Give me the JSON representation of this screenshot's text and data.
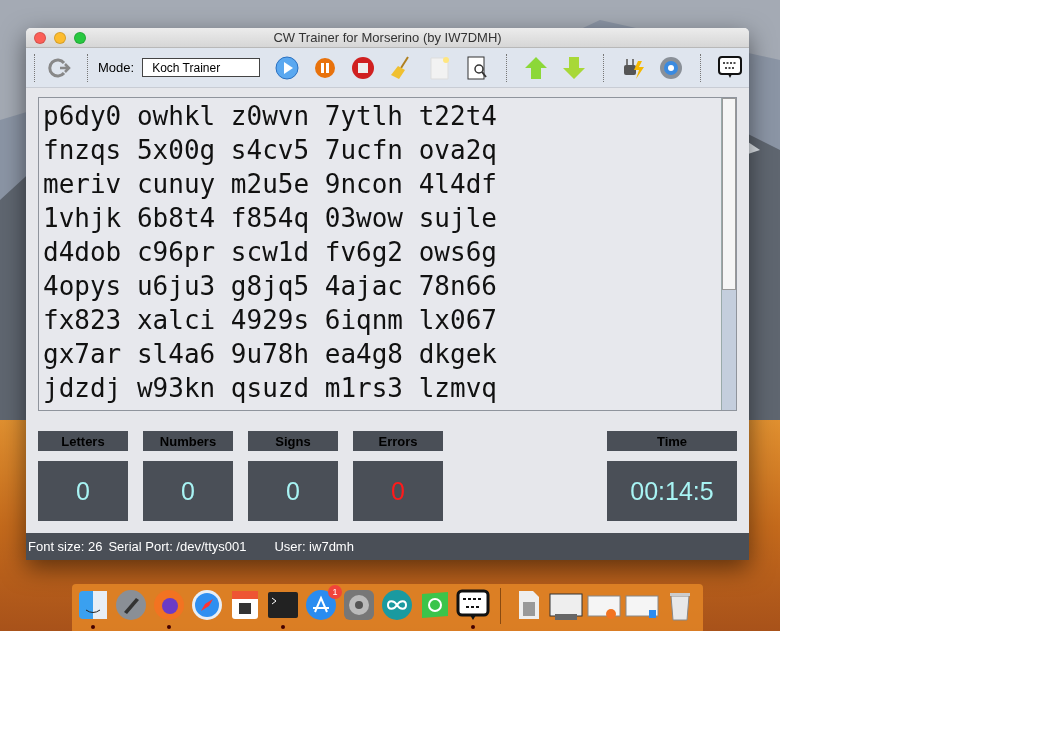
{
  "window": {
    "title": "CW Trainer for Morserino (by IW7DMH)"
  },
  "toolbar": {
    "mode_label": "Mode:",
    "mode_value": "Koch Trainer"
  },
  "text_lines": [
    "p6dy0 owhkl z0wvn 7ytlh t22t4",
    "fnzqs 5x00g s4cv5 7ucfn ova2q",
    "meriv cunuy m2u5e 9ncon 4l4df",
    "1vhjk 6b8t4 f854q 03wow sujle",
    "d4dob c96pr scw1d fv6g2 ows6g",
    "4opys u6ju3 g8jq5 4ajac 78n66",
    "fx823 xalci 4929s 6iqnm lx067",
    "gx7ar sl4a6 9u78h ea4g8 dkgek",
    "jdzdj w93kn qsuzd m1rs3 lzmvq"
  ],
  "stats": [
    {
      "kind": "counter",
      "label": "Letters",
      "value": "0",
      "color": "#a8f4f4"
    },
    {
      "kind": "counter",
      "label": "Numbers",
      "value": "0",
      "color": "#a8f4f4"
    },
    {
      "kind": "counter",
      "label": "Signs",
      "value": "0",
      "color": "#a8f4f4"
    },
    {
      "kind": "counter",
      "label": "Errors",
      "value": "0",
      "color": "#ff1a1a"
    },
    {
      "kind": "time",
      "label": "Time",
      "value": "00:14:5",
      "color": "#a8f4f4"
    }
  ],
  "status_bar": [
    "Font size: 26",
    "Serial Port: /dev/ttys001",
    "User: iw7dmh"
  ],
  "dock": [
    {
      "running": true
    },
    {
      "running": false
    },
    {
      "running": true
    },
    {
      "running": false
    },
    {
      "running": false
    },
    {
      "running": true
    },
    {
      "running": false,
      "badge": "1"
    },
    {
      "running": false
    },
    {
      "running": false
    },
    {
      "running": false
    },
    {
      "running": true
    },
    {
      "running": false
    },
    {
      "running": false
    },
    {
      "running": false
    },
    {
      "running": false
    },
    {
      "running": false
    }
  ]
}
